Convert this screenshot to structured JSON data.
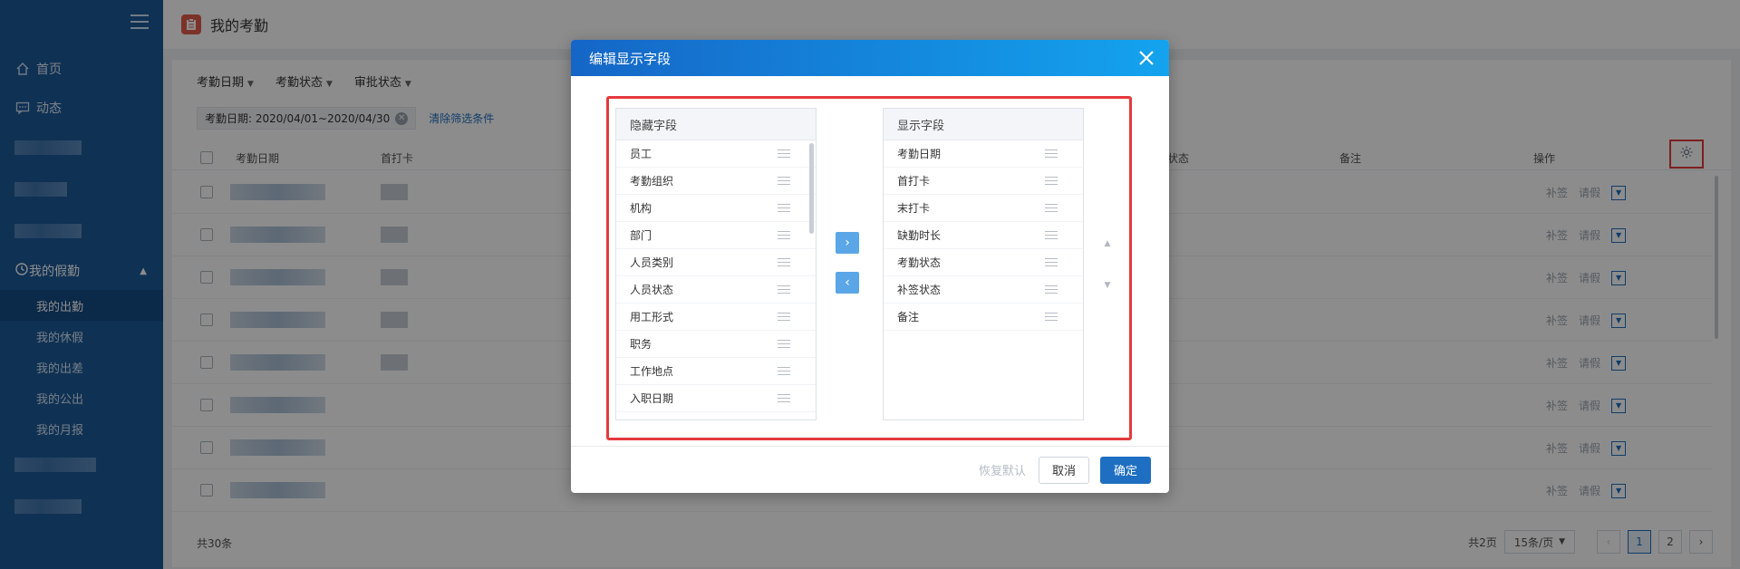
{
  "sidebar": {
    "items": [
      {
        "label": "首页",
        "icon": "home-icon"
      },
      {
        "label": "动态",
        "icon": "message-icon"
      }
    ],
    "group": {
      "label": "我的假勤",
      "icon": "history-icon"
    },
    "sub_items": [
      {
        "label": "我的出勤",
        "active": true
      },
      {
        "label": "我的休假"
      },
      {
        "label": "我的出差"
      },
      {
        "label": "我的公出"
      },
      {
        "label": "我的月报"
      }
    ]
  },
  "header": {
    "title": "我的考勤"
  },
  "filters": {
    "dropdowns": [
      "考勤日期",
      "考勤状态",
      "审批状态"
    ],
    "active_chip": "考勤日期: 2020/04/01~2020/04/30",
    "clear_label": "清除筛选条件"
  },
  "table": {
    "columns": [
      "考勤日期",
      "首打卡",
      "状态",
      "备注",
      "操作"
    ],
    "row_actions": [
      "补签",
      "请假"
    ],
    "row_count_visible": 8
  },
  "footer": {
    "total": "共30条",
    "pages_total": "共2页",
    "page_size": "15条/页",
    "pages": [
      "1",
      "2"
    ],
    "current_page": "1"
  },
  "modal": {
    "title": "编辑显示字段",
    "hidden_header": "隐藏字段",
    "shown_header": "显示字段",
    "hidden_fields": [
      "员工",
      "考勤组织",
      "机构",
      "部门",
      "人员类别",
      "人员状态",
      "用工形式",
      "职务",
      "工作地点",
      "入职日期"
    ],
    "shown_fields": [
      "考勤日期",
      "首打卡",
      "末打卡",
      "缺勤时长",
      "考勤状态",
      "补签状态",
      "备注"
    ],
    "restore_label": "恢复默认",
    "cancel_label": "取消",
    "ok_label": "确定"
  },
  "colors": {
    "sidebar": "#1d5a9a",
    "primary": "#1e6fc2",
    "highlight": "#e4393c"
  }
}
